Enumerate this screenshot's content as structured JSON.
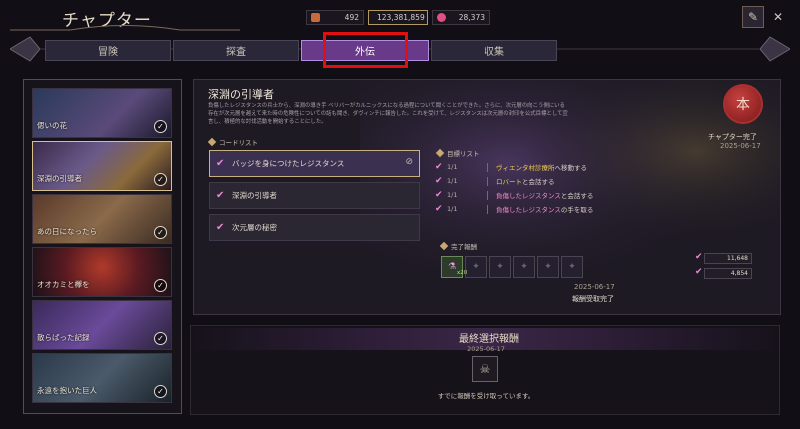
{
  "header": {
    "title": "チャプター",
    "currencies": [
      {
        "icon": "ticket-icon",
        "value": "492",
        "color": "#c86a3a"
      },
      {
        "icon": "gold-coin-icon",
        "value": "123,381,859",
        "color": "#e0b840"
      },
      {
        "icon": "gem-icon",
        "value": "28,373",
        "color": "#e05080"
      }
    ]
  },
  "tabs": [
    {
      "label": "冒険",
      "active": false
    },
    {
      "label": "探査",
      "active": false
    },
    {
      "label": "外伝",
      "active": true
    },
    {
      "label": "収集",
      "active": false
    }
  ],
  "chapters": [
    {
      "label": "偲いの花",
      "completed": true,
      "selected": false
    },
    {
      "label": "深淵の引導者",
      "completed": true,
      "selected": true
    },
    {
      "label": "あの日になったら",
      "completed": true,
      "selected": false
    },
    {
      "label": "オオカミと欅を",
      "completed": true,
      "selected": false
    },
    {
      "label": "散らばった記録",
      "completed": true,
      "selected": false
    },
    {
      "label": "永遠を抱いた巨人",
      "completed": true,
      "selected": false
    }
  ],
  "detail": {
    "title": "深淵の引導者",
    "description": "負傷したレジスタンスの兵士から、深淵の導き手 ベリバーがカルニックスになる過程について聞くことができた。さらに、次元層の向こう側にいる存在が次元層を越えて来た時の危険性についての話も聞き、ダヴィンチに報告した。これを受けて、レジスタンスは次元層の封印を公式目標として宣言し、積極的な討伐活動を開始することにした。",
    "status_label": "チャプター完了",
    "status_date": "2025-06-17",
    "seal_glyph": "本",
    "code_list_label": "コードリスト",
    "codes": [
      {
        "label": "バッジを身につけたレジスタンス",
        "active": true
      },
      {
        "label": "深淵の引導者",
        "active": false
      },
      {
        "label": "次元層の秘密",
        "active": false
      }
    ],
    "goals_label": "目標リスト",
    "goals": [
      {
        "count": "1/1",
        "highlight": "ヴィエンタ村診療所",
        "highlight_color": "yellow",
        "rest": "へ移動する"
      },
      {
        "count": "1/1",
        "highlight": "ロバート",
        "highlight_color": "pink",
        "rest": "と会話する"
      },
      {
        "count": "1/1",
        "highlight": "負傷したレジスタンス",
        "highlight_color": "pink",
        "rest": "と会話する"
      },
      {
        "count": "1/1",
        "highlight": "負傷したレジスタンス",
        "highlight_color": "pink",
        "rest": "の手を取る"
      }
    ],
    "reward_label": "完了報酬",
    "reward_item_count": "x20",
    "reward_chips": [
      "11,648",
      "4,854"
    ],
    "reward_date": "2025-06-17",
    "reward_status": "報酬受取完了"
  },
  "final": {
    "title": "最終選択報酬",
    "date": "2025-06-17",
    "message": "すでに報酬を受け取っています。"
  }
}
